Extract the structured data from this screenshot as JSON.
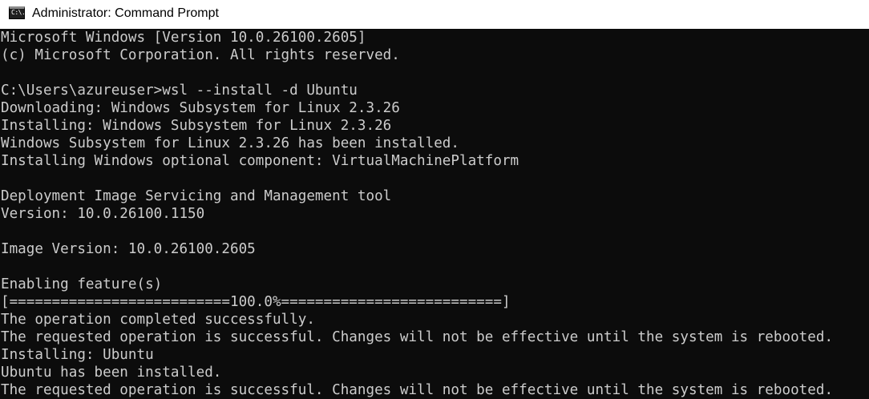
{
  "window": {
    "title": "Administrator: Command Prompt",
    "icon": "cmd-icon",
    "icon_text": "C:\\."
  },
  "console": {
    "lines": [
      "Microsoft Windows [Version 10.0.26100.2605]",
      "(c) Microsoft Corporation. All rights reserved.",
      "",
      "C:\\Users\\azureuser>wsl --install -d Ubuntu",
      "Downloading: Windows Subsystem for Linux 2.3.26",
      "Installing: Windows Subsystem for Linux 2.3.26",
      "Windows Subsystem for Linux 2.3.26 has been installed.",
      "Installing Windows optional component: VirtualMachinePlatform",
      "",
      "Deployment Image Servicing and Management tool",
      "Version: 10.0.26100.1150",
      "",
      "Image Version: 10.0.26100.2605",
      "",
      "Enabling feature(s)",
      "[==========================100.0%==========================]",
      "The operation completed successfully.",
      "The requested operation is successful. Changes will not be effective until the system is rebooted.",
      "Installing: Ubuntu",
      "Ubuntu has been installed.",
      "The requested operation is successful. Changes will not be effective until the system is rebooted."
    ]
  },
  "colors": {
    "console_background": "#0c0c0c",
    "console_text": "#cccccc",
    "titlebar_background": "#ffffff"
  }
}
